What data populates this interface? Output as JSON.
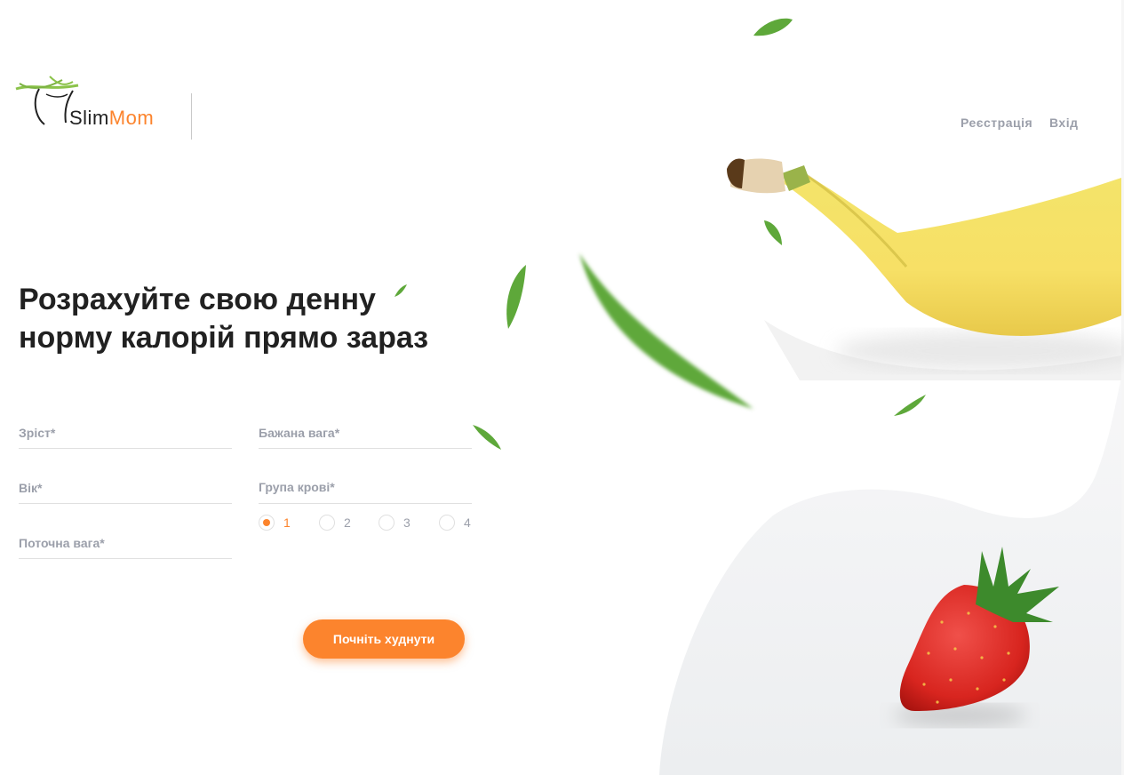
{
  "logo": {
    "slim": "Slim",
    "mom": "Mom"
  },
  "nav": {
    "register": "Реєстрація",
    "login": "Вхід"
  },
  "heading": {
    "line1": "Розрахуйте свою денну",
    "line2": "норму калорій прямо зараз"
  },
  "form": {
    "height_placeholder": "Зріст*",
    "age_placeholder": "Вік*",
    "current_weight_placeholder": "Поточна вага*",
    "desired_weight_placeholder": "Бажана вага*",
    "blood_type_label": "Група крові*",
    "blood_types": [
      "1",
      "2",
      "3",
      "4"
    ],
    "selected_blood_type": "1",
    "submit_label": "Почніть худнути"
  },
  "colors": {
    "accent": "#fc842d",
    "text": "#212121",
    "muted": "#9b9faa",
    "background_shape": "#f0f1f3"
  },
  "icons": [
    "slimmom-logo-icon",
    "banana-image",
    "strawberry-image",
    "leaf-image"
  ]
}
